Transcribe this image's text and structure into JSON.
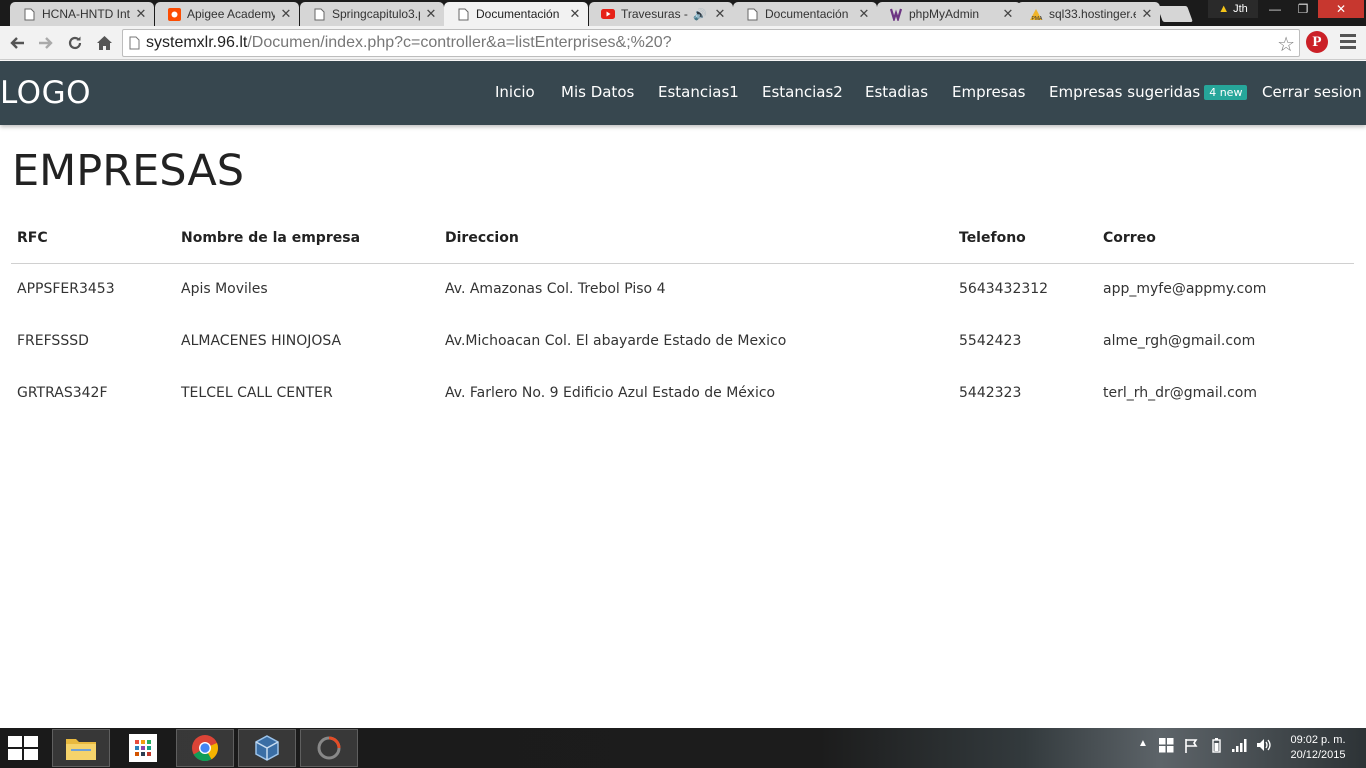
{
  "browser": {
    "tabs": [
      {
        "title": "HCNA-HNTD Intr",
        "icon": "page-icon",
        "active": false
      },
      {
        "title": "Apigee Academy",
        "icon": "apigee-icon",
        "active": false
      },
      {
        "title": "Springcapitulo3.p",
        "icon": "page-icon",
        "active": false
      },
      {
        "title": "Documentación",
        "icon": "page-icon",
        "active": true
      },
      {
        "title": "Travesuras - M",
        "icon": "youtube-icon",
        "active": false
      },
      {
        "title": "Documentación",
        "icon": "page-icon",
        "active": false
      },
      {
        "title": "phpMyAdmin",
        "icon": "phpmyadmin-icon",
        "active": false
      },
      {
        "title": "sql33.hostinger.e",
        "icon": "pma-icon",
        "active": false
      }
    ],
    "profile_name": "Jth",
    "address_host": "systemxlr.96.lt",
    "address_path": "/Documen/index.php?c=controller&a=listEnterprises&;%20?"
  },
  "site": {
    "logo": "LOGO",
    "nav": {
      "inicio": "Inicio",
      "mis_datos": "Mis Datos",
      "estancias1": "Estancias1",
      "estancias2": "Estancias2",
      "estadias": "Estadias",
      "empresas": "Empresas",
      "empresas_sugeridas": "Empresas sugeridas",
      "badge": "4 new",
      "cerrar_sesion": "Cerrar sesion"
    },
    "page_title": "EMPRESAS",
    "table": {
      "headers": [
        "RFC",
        "Nombre de la empresa",
        "Direccion",
        "Telefono",
        "Correo"
      ],
      "rows": [
        [
          "APPSFER3453",
          "Apis Moviles",
          "Av. Amazonas Col. Trebol Piso 4",
          "5643432312",
          "app_myfe@appmy.com"
        ],
        [
          "FREFSSSD",
          "ALMACENES HINOJOSA",
          "Av.Michoacan Col. El abayarde Estado de Mexico",
          "5542423",
          "alme_rgh@gmail.com"
        ],
        [
          "GRTRAS342F",
          "TELCEL CALL CENTER",
          "Av. Farlero No. 9 Edificio Azul Estado de México",
          "5442323",
          "terl_rh_dr@gmail.com"
        ]
      ]
    }
  },
  "taskbar": {
    "time": "09:02 p. m.",
    "date": "20/12/2015"
  },
  "colors": {
    "navbar": "#37474f",
    "badge": "#26a69a",
    "pinterest": "#cb2027"
  }
}
